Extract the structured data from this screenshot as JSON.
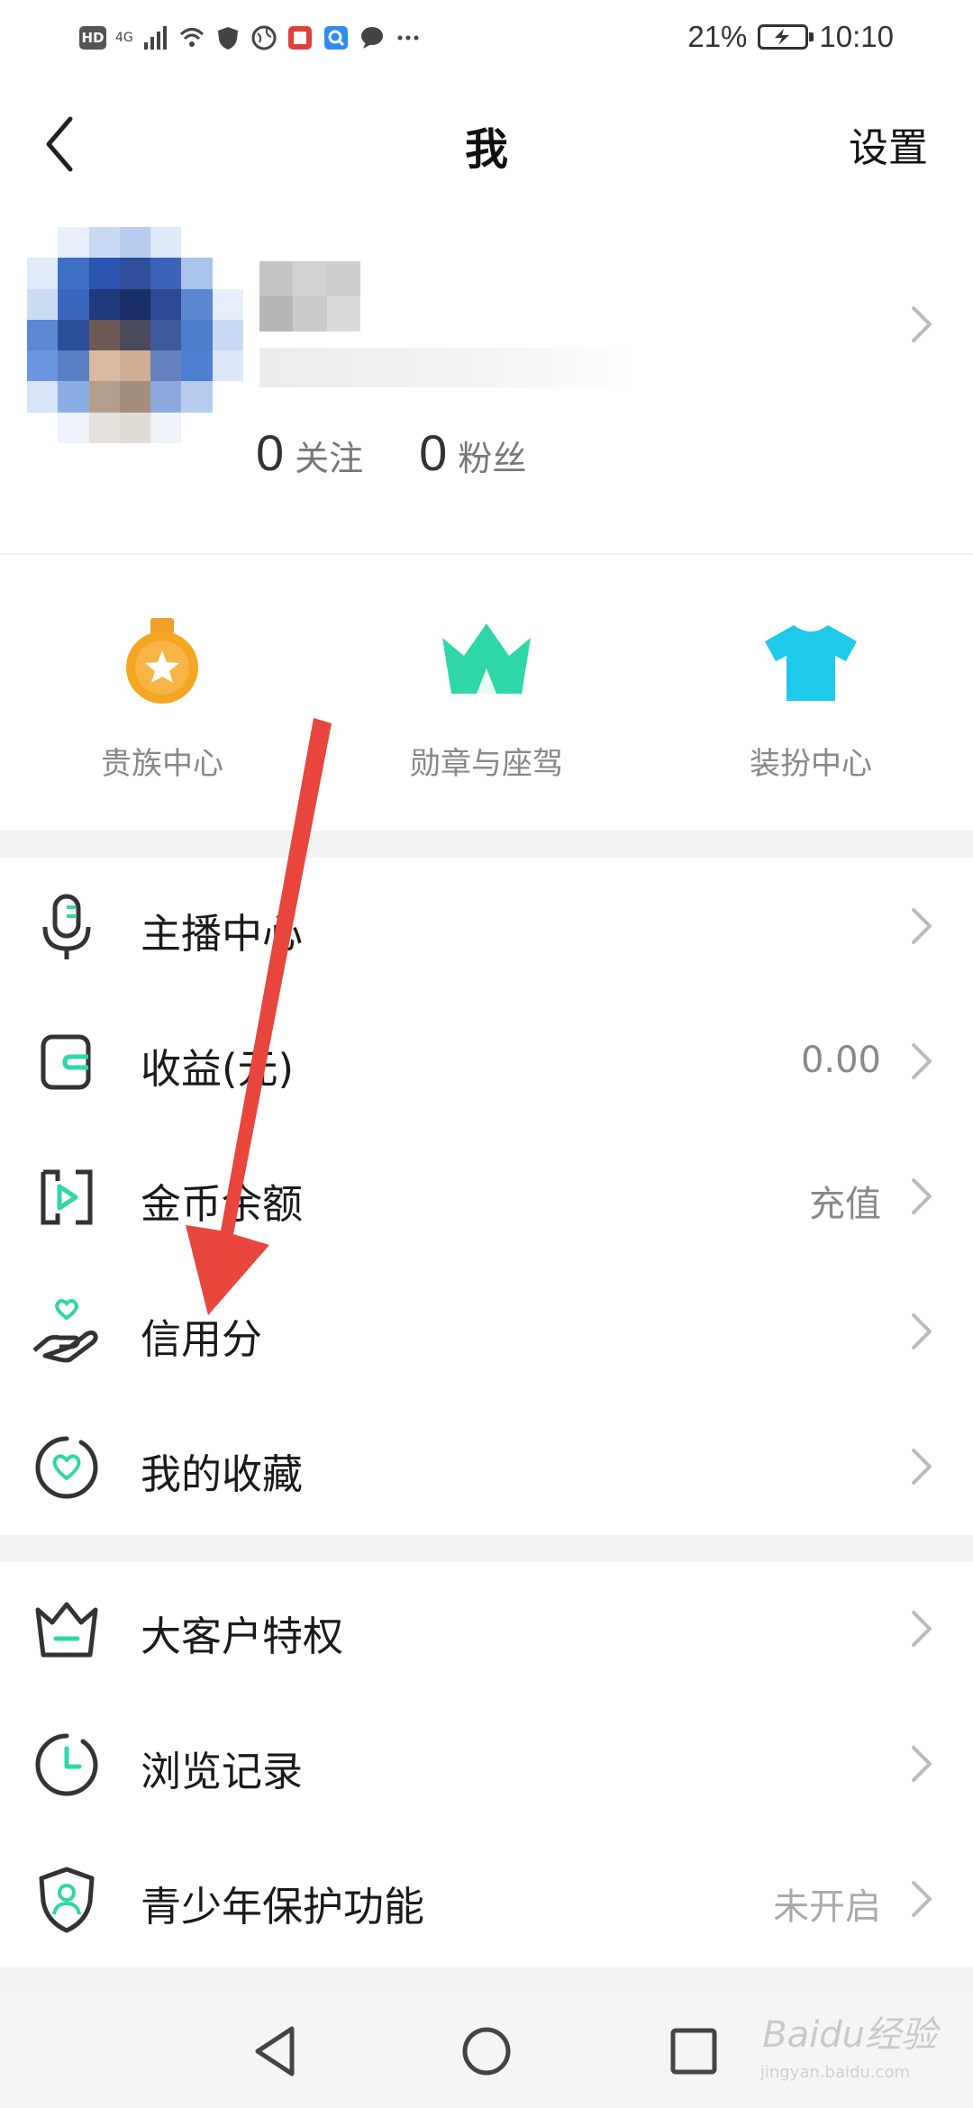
{
  "status_bar": {
    "left_labels": [
      "HD",
      "4G"
    ],
    "battery": "21%",
    "time": "10:10"
  },
  "header": {
    "title": "我",
    "settings_label": "设置"
  },
  "profile": {
    "following_count": "0",
    "following_label": "关注",
    "followers_count": "0",
    "followers_label": "粉丝"
  },
  "quick_access": [
    {
      "label": "贵族中心",
      "icon": "medal-icon",
      "color": "#f5a623"
    },
    {
      "label": "勋章与座驾",
      "icon": "crown-icon",
      "color": "#2ed6a8"
    },
    {
      "label": "装扮中心",
      "icon": "tshirt-icon",
      "color": "#1ec9ea"
    }
  ],
  "menu_group_1": [
    {
      "label": "主播中心",
      "value": "",
      "icon": "microphone-icon"
    },
    {
      "label": "收益(元)",
      "value": "0.00",
      "icon": "wallet-icon"
    },
    {
      "label": "金币余额",
      "value": "充值",
      "icon": "coin-balance-icon"
    },
    {
      "label": "信用分",
      "value": "",
      "icon": "hand-heart-icon"
    },
    {
      "label": "我的收藏",
      "value": "",
      "icon": "favorite-heart-icon"
    }
  ],
  "menu_group_2": [
    {
      "label": "大客户特权",
      "value": "",
      "icon": "vip-crown-icon"
    },
    {
      "label": "浏览记录",
      "value": "",
      "icon": "clock-icon"
    },
    {
      "label": "青少年保护功能",
      "value": "未开启",
      "icon": "shield-user-icon"
    }
  ],
  "watermark": {
    "brand": "Baidu经验",
    "url": "jingyan.baidu.com"
  },
  "colors": {
    "accent": "#2ed6a8",
    "arrow": "#e8453c",
    "band": "#f3f3f3"
  }
}
